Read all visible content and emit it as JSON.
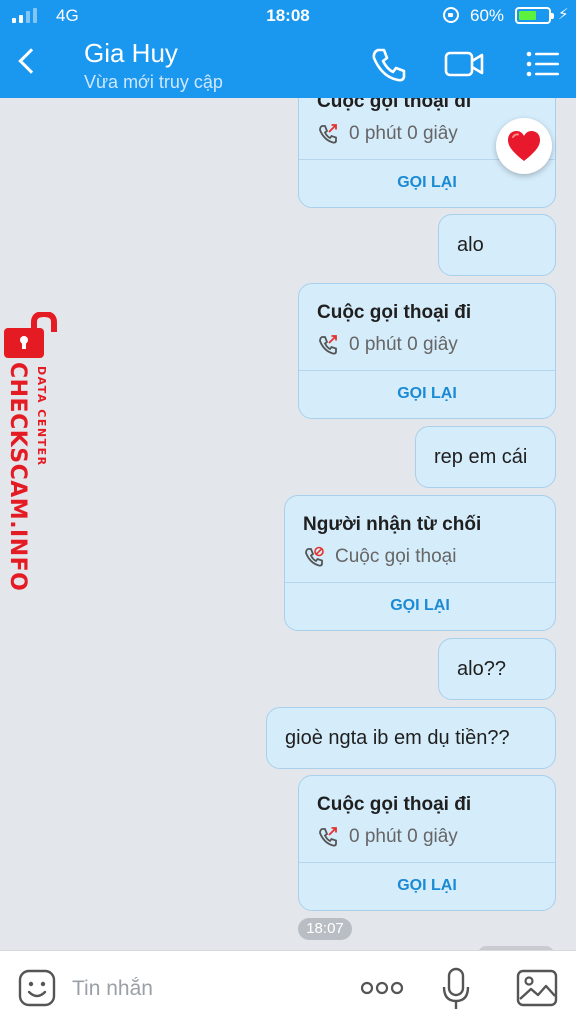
{
  "status_bar": {
    "network": "4G",
    "time": "18:08",
    "battery_percent": "60%",
    "battery_level": 0.6
  },
  "header": {
    "contact_name": "Gia Huy",
    "contact_status": "Vừa mới truy cập"
  },
  "messages": [
    {
      "type": "call",
      "title": "Cuộc gọi thoại đi",
      "detail": "0 phút 0 giây",
      "action": "GỌI LẠI",
      "reaction": "heart"
    },
    {
      "type": "text",
      "text": "alo"
    },
    {
      "type": "call",
      "title": "Cuộc gọi thoại đi",
      "detail": "0 phút 0 giây",
      "action": "GỌI LẠI"
    },
    {
      "type": "text",
      "text": "rep em cái"
    },
    {
      "type": "call",
      "title": "Người nhận từ chối",
      "detail": "Cuộc gọi thoại",
      "action": "GỌI LẠI"
    },
    {
      "type": "text",
      "text": "alo??"
    },
    {
      "type": "text",
      "text": "gioè ngta ib em dụ tiền??"
    },
    {
      "type": "call",
      "title": "Cuộc gọi thoại đi",
      "detail": "0 phút 0 giây",
      "action": "GỌI LẠI"
    }
  ],
  "timestamp": "18:07",
  "watermark": {
    "main": "CHECKSCAM.INFO",
    "sub": "DATA CENTER"
  },
  "input": {
    "placeholder": "Tin nhắn"
  },
  "colors": {
    "header": "#1a97ee",
    "bubble": "#d5ecfb",
    "recall": "#1a8ad4",
    "watermark": "#e51b23"
  }
}
